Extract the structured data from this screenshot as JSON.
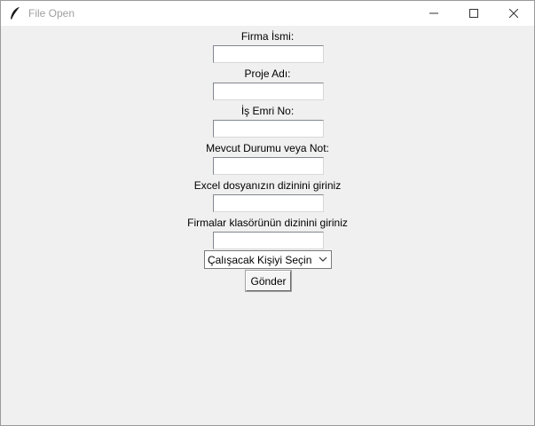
{
  "window": {
    "title": "File Open",
    "controls": [
      "minimize-icon",
      "maximize-icon",
      "close-icon"
    ]
  },
  "form": {
    "fields": [
      {
        "label": "Firma İsmi:",
        "value": ""
      },
      {
        "label": "Proje Adı:",
        "value": ""
      },
      {
        "label": "İş Emri No:",
        "value": ""
      },
      {
        "label": "Mevcut Durumu veya Not:",
        "value": ""
      },
      {
        "label": "Excel dosyanızın dizinini giriniz",
        "value": ""
      },
      {
        "label": "Firmalar klasörünün dizinini giriniz",
        "value": ""
      }
    ],
    "person_select": {
      "selected": "Çalışacak Kişiyi Seçin"
    },
    "submit_label": "Gönder"
  }
}
